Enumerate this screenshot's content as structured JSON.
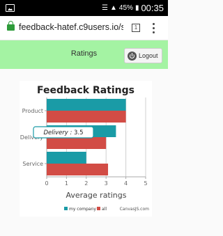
{
  "status_bar": {
    "battery_percent": "45%",
    "time": "00:35"
  },
  "browser": {
    "url": "feedback-hatef.c9users.io/s",
    "tab_count": "1"
  },
  "header": {
    "title": "Ratings",
    "logout_label": "Logout"
  },
  "chart_data": {
    "type": "bar",
    "orientation": "horizontal",
    "title": "Feedback Ratings",
    "xlabel": "Average ratings",
    "ylabel": "",
    "categories": [
      "Product",
      "Delivery",
      "Service"
    ],
    "series": [
      {
        "name": "my company",
        "color": "#1a9ba6",
        "values": [
          4,
          3.5,
          2
        ]
      },
      {
        "name": "all",
        "color": "#d24c45",
        "values": [
          4,
          3,
          3.1
        ]
      }
    ],
    "xlim": [
      0,
      5
    ],
    "ticks": [
      "0",
      "1",
      "2",
      "3",
      "4",
      "5"
    ],
    "grid": true,
    "legend": "bottom",
    "tooltip": {
      "label": "Delivery",
      "separator": ":",
      "value": "3.5"
    },
    "credit": "CanvasJS.com"
  }
}
